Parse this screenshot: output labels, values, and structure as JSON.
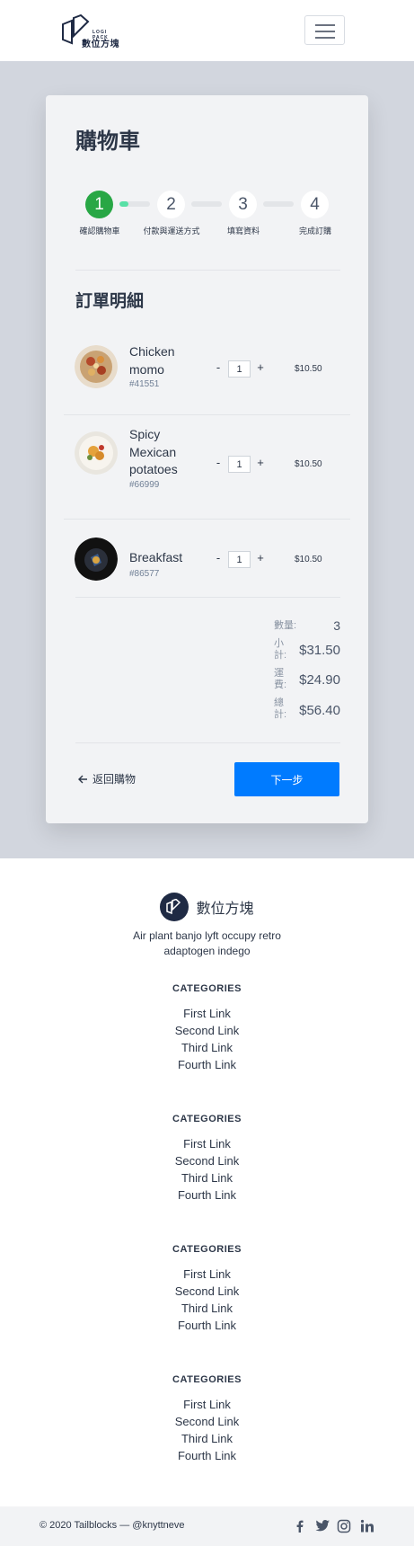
{
  "header": {
    "logo_small": "LOGI PACK",
    "logo_text": "數位方塊",
    "menu_icon": "hamburger-menu-icon"
  },
  "cart": {
    "title": "購物車",
    "steps": [
      {
        "number": "1",
        "label": "確認購物車",
        "active": true
      },
      {
        "number": "2",
        "label": "付款與運送方式",
        "active": false
      },
      {
        "number": "3",
        "label": "填寫資料",
        "active": false
      },
      {
        "number": "4",
        "label": "完成訂購",
        "active": false
      }
    ],
    "progress": 0.3,
    "section_title": "訂單明細",
    "items": [
      {
        "name": "Chicken momo",
        "sku": "#41551",
        "qty": "1",
        "price": "$10.50",
        "image": "food-photo-chicken-momo"
      },
      {
        "name": "Spicy Mexican potatoes",
        "sku": "#66999",
        "qty": "1",
        "price": "$10.50",
        "image": "food-photo-mexican-potatoes"
      },
      {
        "name": "Breakfast",
        "sku": "#86577",
        "qty": "1",
        "price": "$10.50",
        "image": "food-photo-breakfast"
      }
    ],
    "minus": "-",
    "plus": "+",
    "summary": {
      "qty_label": "數量:",
      "qty_value": "3",
      "subtotal_label": "小計:",
      "subtotal_value": "$31.50",
      "shipping_label": "運費:",
      "shipping_value": "$24.90",
      "total_label": "總計:",
      "total_value": "$56.40"
    },
    "back_label": "返回購物",
    "next_label": "下一步"
  },
  "footer": {
    "brand": "數位方塊",
    "description": "Air plant banjo lyft occupy retro adaptogen indego",
    "categories": [
      {
        "title": "CATEGORIES",
        "links": [
          "First Link",
          "Second Link",
          "Third Link",
          "Fourth Link"
        ]
      },
      {
        "title": "CATEGORIES",
        "links": [
          "First Link",
          "Second Link",
          "Third Link",
          "Fourth Link"
        ]
      },
      {
        "title": "CATEGORIES",
        "links": [
          "First Link",
          "Second Link",
          "Third Link",
          "Fourth Link"
        ]
      },
      {
        "title": "CATEGORIES",
        "links": [
          "First Link",
          "Second Link",
          "Third Link",
          "Fourth Link"
        ]
      }
    ],
    "copyright": "© 2020 Tailblocks — @knyttneve",
    "social": [
      "facebook-icon",
      "twitter-icon",
      "instagram-icon",
      "linkedin-icon"
    ]
  },
  "colors": {
    "accent": "#007bff",
    "step_active": "#28a745",
    "progress": "#59e0a6",
    "hero_bg": "#d2d6de",
    "card_bg": "#f2f3f5"
  }
}
